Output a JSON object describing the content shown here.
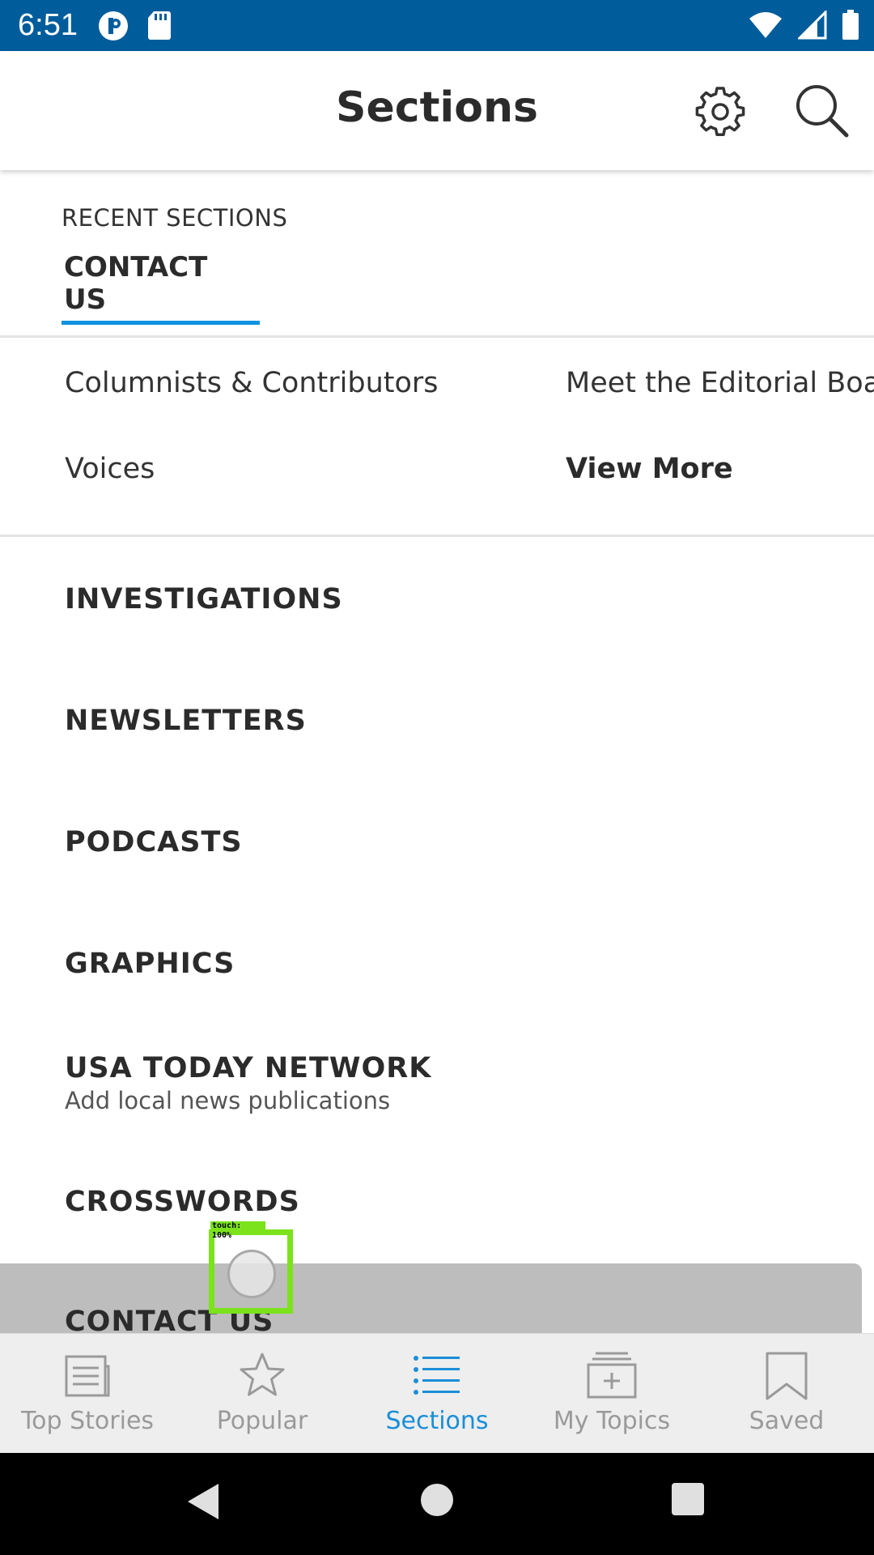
{
  "status_bar": {
    "time": "6:51",
    "icons": [
      "p-icon",
      "sd-card-icon",
      "wifi-icon",
      "signal-icon",
      "battery-icon"
    ]
  },
  "header": {
    "title": "Sections"
  },
  "recent_sections": {
    "label": "RECENT SECTIONS",
    "items": [
      "CONTACT US"
    ]
  },
  "subsections": {
    "items": [
      "Columnists & Contributors",
      "Meet the Editorial Boa",
      "Voices",
      "View More"
    ]
  },
  "sections": {
    "items": [
      {
        "label": "INVESTIGATIONS"
      },
      {
        "label": "NEWSLETTERS"
      },
      {
        "label": "PODCASTS"
      },
      {
        "label": "GRAPHICS"
      },
      {
        "label": "USA TODAY NETWORK",
        "sublabel": "Add local news publications"
      },
      {
        "label": "CROSSWORDS"
      },
      {
        "label": "CONTACT US"
      }
    ]
  },
  "touch_indicator": {
    "label": "touch: 100%"
  },
  "tabs": [
    {
      "label": "Top Stories",
      "icon": "newspaper-icon",
      "active": false
    },
    {
      "label": "Popular",
      "icon": "star-icon",
      "active": false
    },
    {
      "label": "Sections",
      "icon": "list-icon",
      "active": true
    },
    {
      "label": "My Topics",
      "icon": "add-topic-icon",
      "active": false
    },
    {
      "label": "Saved",
      "icon": "bookmark-icon",
      "active": false
    }
  ],
  "colors": {
    "status_bar": "#005c9b",
    "accent": "#1a8ed8",
    "underline": "#0f92e0",
    "touch_box": "#7be21c",
    "pressed_row": "#bdbdbd"
  }
}
